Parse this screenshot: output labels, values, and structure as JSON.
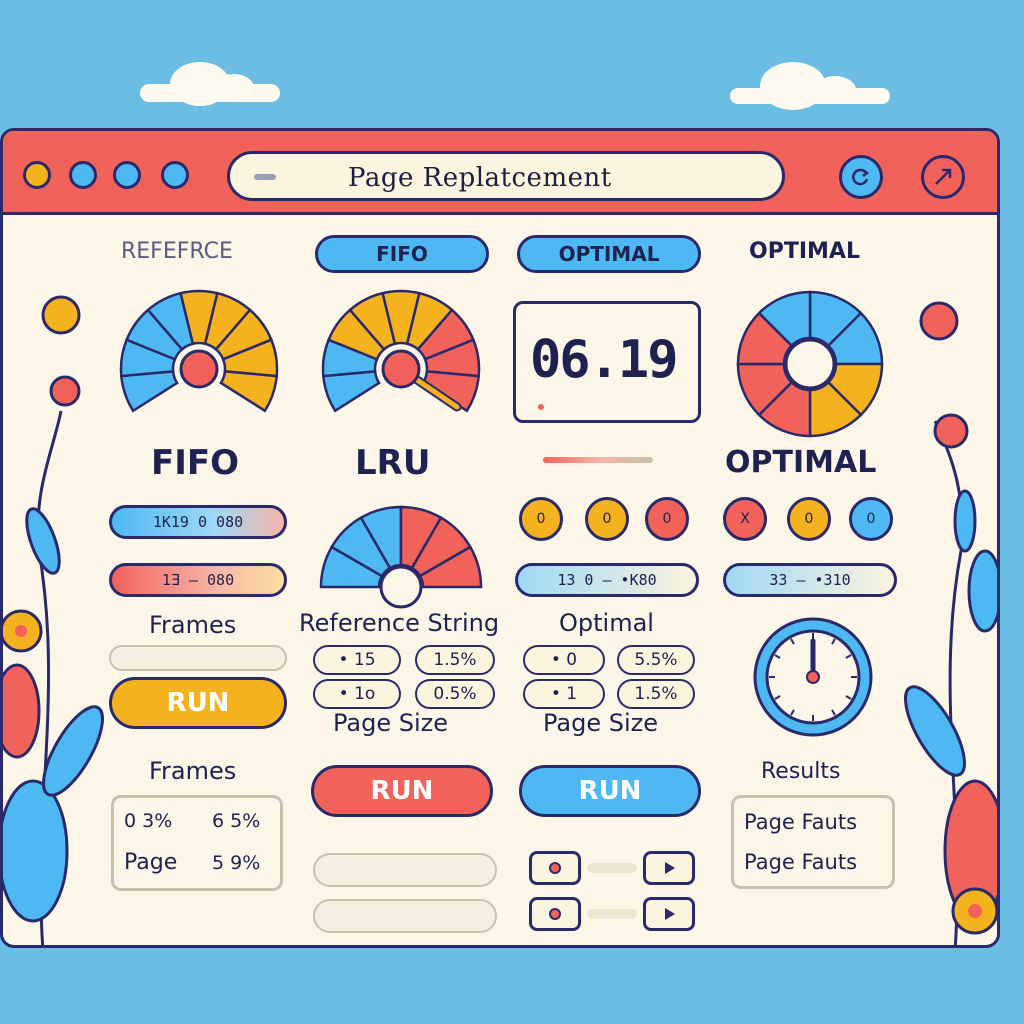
{
  "window": {
    "title": "Page Replatcement"
  },
  "tabs": {
    "reference": "REFEFRCE",
    "fifo": "FIFO",
    "optimal_tab": "OPTIMAL",
    "optimal_label": "OPTIMAL"
  },
  "gauges": {
    "fifo_label": "FIFO",
    "lru_label": "LRU",
    "optimal_label": "OPTIMAL",
    "display_value": "06.19"
  },
  "bars": {
    "fifo_top": "1K19  0  080",
    "fifo_bottom": "1Ǝ  —  080",
    "optimal_bar": "13 0  —  •K80",
    "optimal_bar_2": "33  —  •310"
  },
  "labels": {
    "frames": "Frames",
    "reference_string": "Reference String",
    "optimal": "Optimal",
    "page_size_1": "Page Size",
    "page_size_2": "Page Size",
    "frames_2": "Frames",
    "results": "Results"
  },
  "pills": {
    "ref_a": "• 15",
    "ref_b": "1.5%",
    "ref_c": "• 1o",
    "ref_d": "0.5%",
    "opt_a": "• 0",
    "opt_b": "5.5%",
    "opt_c": "• 1",
    "opt_d": "1.5%"
  },
  "buttons": {
    "run_fifo": "RUN",
    "run_lru": "RUN",
    "run_optimal": "RUN"
  },
  "circles": {
    "c1": "0",
    "c2": "0",
    "c3": "0",
    "c4": "X",
    "c5": "0",
    "c6": "0"
  },
  "frames_box": {
    "row1_a": "0 3%",
    "row1_b": "6 5%",
    "row2_a": "Page",
    "row2_b": "5 9%"
  },
  "results_box": {
    "line1": "Page Fauts",
    "line2": "Page Fauts"
  },
  "colors": {
    "background": "#6bbde3",
    "titlebar": "#f0625a",
    "window": "#fbf6e8",
    "blue": "#4db8f2",
    "orange": "#f5b21f",
    "red": "#f0625a",
    "outline": "#2a2a6a"
  }
}
